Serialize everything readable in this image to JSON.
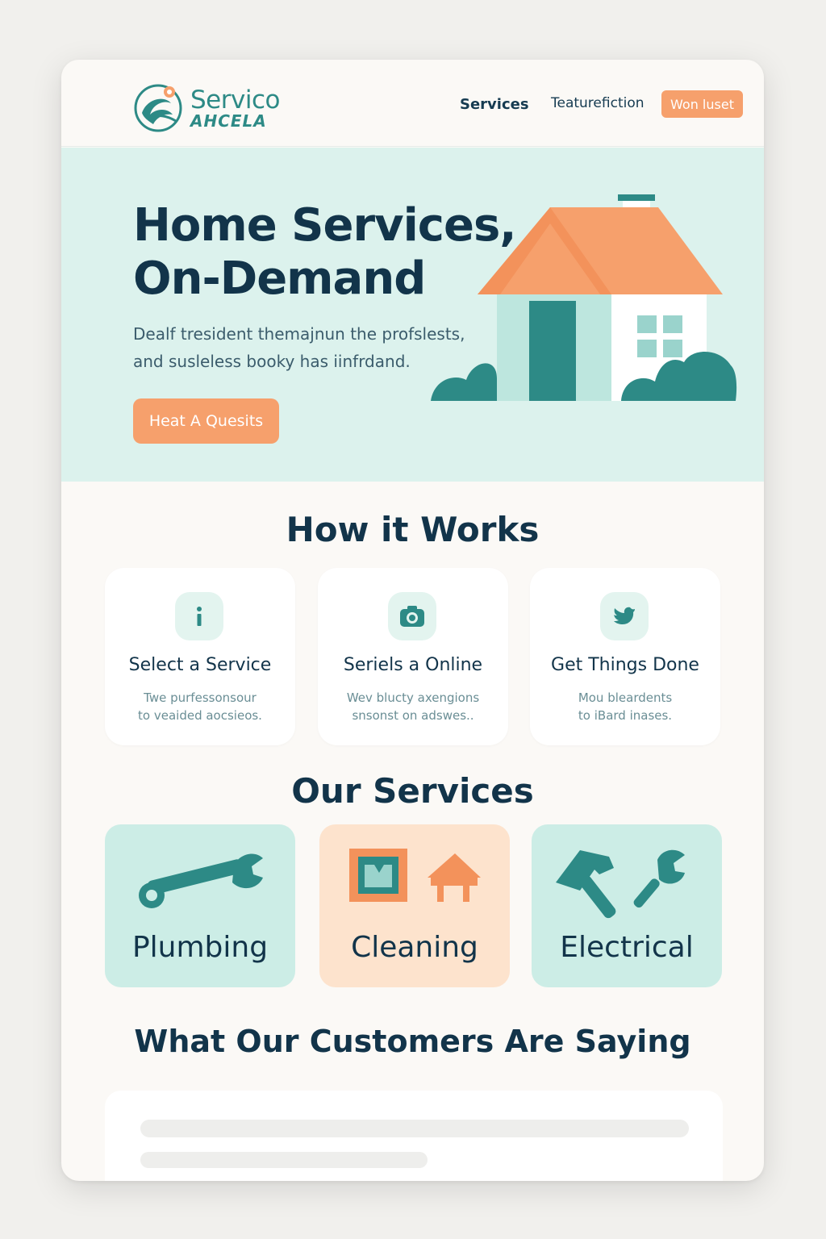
{
  "brand": {
    "name_line1": "Servico",
    "name_line2": "AHCELA"
  },
  "nav": {
    "services_label": "Services",
    "features_label": "Teaturefiction",
    "cta_label": "Won luset"
  },
  "hero": {
    "title_line1": "Home Services,",
    "title_line2": "On-Demand",
    "subtitle_line1": "Dealf tresident themajnun the profslests,",
    "subtitle_line2": "and susleless booky has iinfrdand.",
    "cta_label": "Heat A Quesits"
  },
  "how_it_works": {
    "title": "How it Works",
    "steps": [
      {
        "icon": "info-icon",
        "title": "Select a Service",
        "desc_line1": "Twe purfessonsour",
        "desc_line2": "to veaided aocsieos."
      },
      {
        "icon": "camera-icon",
        "title": "Seriels a Online",
        "desc_line1": "Wev blucty axengions",
        "desc_line2": "snsonst on adswes.."
      },
      {
        "icon": "bird-icon",
        "title": "Get Things Done",
        "desc_line1": "Mou bleardents",
        "desc_line2": "to iBard inases."
      }
    ]
  },
  "services": {
    "title": "Our Services",
    "items": [
      {
        "label": "Plumbing",
        "icon": "wrench-icon",
        "bg": "#ccede6"
      },
      {
        "label": "Cleaning",
        "icon": "house-frame-icon",
        "bg": "#fde3cd"
      },
      {
        "label": "Electrical",
        "icon": "hammer-wrench-icon",
        "bg": "#ccede6"
      }
    ]
  },
  "testimonials": {
    "title": "What Our Customers Are Saying"
  },
  "colors": {
    "accent_orange": "#f6a06c",
    "teal": "#2d8a86",
    "navy": "#12344a",
    "mint": "#dcf2ed"
  }
}
